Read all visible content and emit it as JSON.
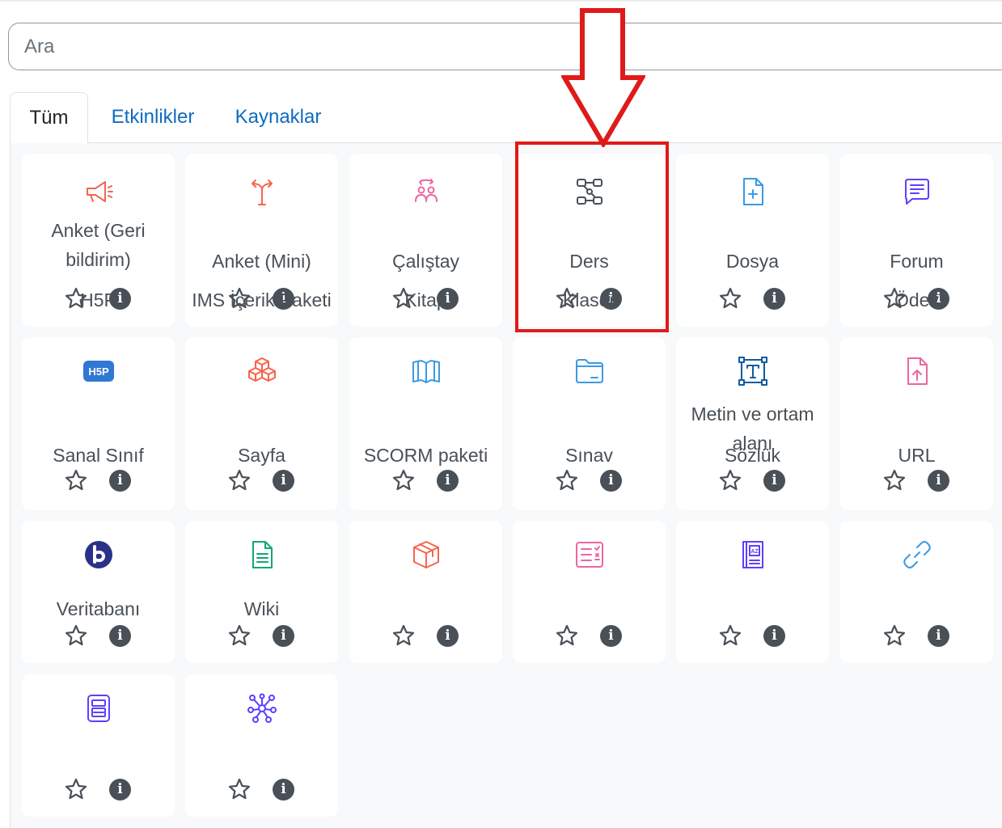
{
  "search": {
    "placeholder": "Ara"
  },
  "tabs": [
    {
      "label": "Tüm",
      "active": true
    },
    {
      "label": "Etkinlikler",
      "active": false
    },
    {
      "label": "Kaynaklar",
      "active": false
    }
  ],
  "modules": [
    {
      "name": "Anket (Geri bildirim)",
      "icon": "megaphone-icon",
      "color": "#f7634d"
    },
    {
      "name": "Anket (Mini)",
      "icon": "signpost-icon",
      "color": "#f7634d"
    },
    {
      "name": "Çalıştay",
      "icon": "workshop-icon",
      "color": "#eb66a2"
    },
    {
      "name": "Ders",
      "icon": "lesson-icon",
      "color": "#495057"
    },
    {
      "name": "Dosya",
      "icon": "file-icon",
      "color": "#399be2"
    },
    {
      "name": "Forum",
      "icon": "forum-icon",
      "color": "#5b40ff"
    },
    {
      "name": "H5P",
      "icon": "h5p-icon",
      "color": "#2f78d4"
    },
    {
      "name": "IMS İçerik Paketi",
      "icon": "package-icon",
      "color": "#f7634d"
    },
    {
      "name": "Kitap",
      "icon": "book-icon",
      "color": "#399be2"
    },
    {
      "name": "Klasör",
      "icon": "folder-icon",
      "color": "#399be2"
    },
    {
      "name": "Metin ve ortam alanı",
      "icon": "text-area-icon",
      "color": "#0d5ca1"
    },
    {
      "name": "Ödev",
      "icon": "assignment-icon",
      "color": "#eb66a2"
    },
    {
      "name": "Sanal Sınıf",
      "icon": "bigbluebutton-icon",
      "color": "#2a3288"
    },
    {
      "name": "Sayfa",
      "icon": "page-icon",
      "color": "#11a676"
    },
    {
      "name": "SCORM paketi",
      "icon": "scorm-box-icon",
      "color": "#f7634d"
    },
    {
      "name": "Sınav",
      "icon": "quiz-icon",
      "color": "#eb66a2"
    },
    {
      "name": "Sözlük",
      "icon": "glossary-icon",
      "color": "#5b40ff"
    },
    {
      "name": "URL",
      "icon": "link-icon",
      "color": "#399be2"
    },
    {
      "name": "Veritabanı",
      "icon": "database-icon",
      "color": "#5b40ff"
    },
    {
      "name": "Wiki",
      "icon": "wiki-icon",
      "color": "#5b40ff"
    }
  ],
  "info_glyph": "i"
}
